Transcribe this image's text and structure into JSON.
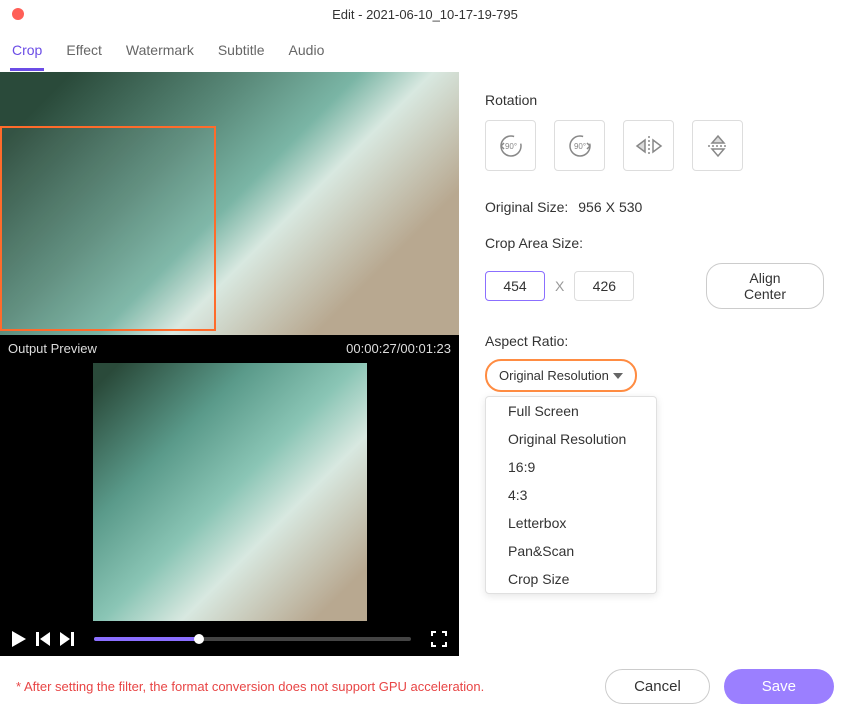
{
  "window": {
    "title": "Edit - 2021-06-10_10-17-19-795"
  },
  "tabs": {
    "items": [
      "Crop",
      "Effect",
      "Watermark",
      "Subtitle",
      "Audio"
    ],
    "active_index": 0
  },
  "preview": {
    "label": "Output Preview",
    "time": "00:00:27/00:01:23"
  },
  "rotation": {
    "label": "Rotation",
    "ccw_label": "90°",
    "cw_label": "90°"
  },
  "original_size": {
    "label": "Original Size:",
    "width": "956",
    "sep": "X",
    "height": "530"
  },
  "crop_area": {
    "label": "Crop Area Size:",
    "width": "454",
    "height": "426",
    "sep": "X",
    "align_label": "Align Center"
  },
  "aspect_ratio": {
    "label": "Aspect Ratio:",
    "selected": "Original Resolution",
    "options": [
      "Full Screen",
      "Original Resolution",
      "16:9",
      "4:3",
      "Letterbox",
      "Pan&Scan",
      "Crop Size"
    ]
  },
  "footer": {
    "warning": "* After setting the filter, the format conversion does not support GPU acceleration.",
    "cancel": "Cancel",
    "save": "Save"
  }
}
